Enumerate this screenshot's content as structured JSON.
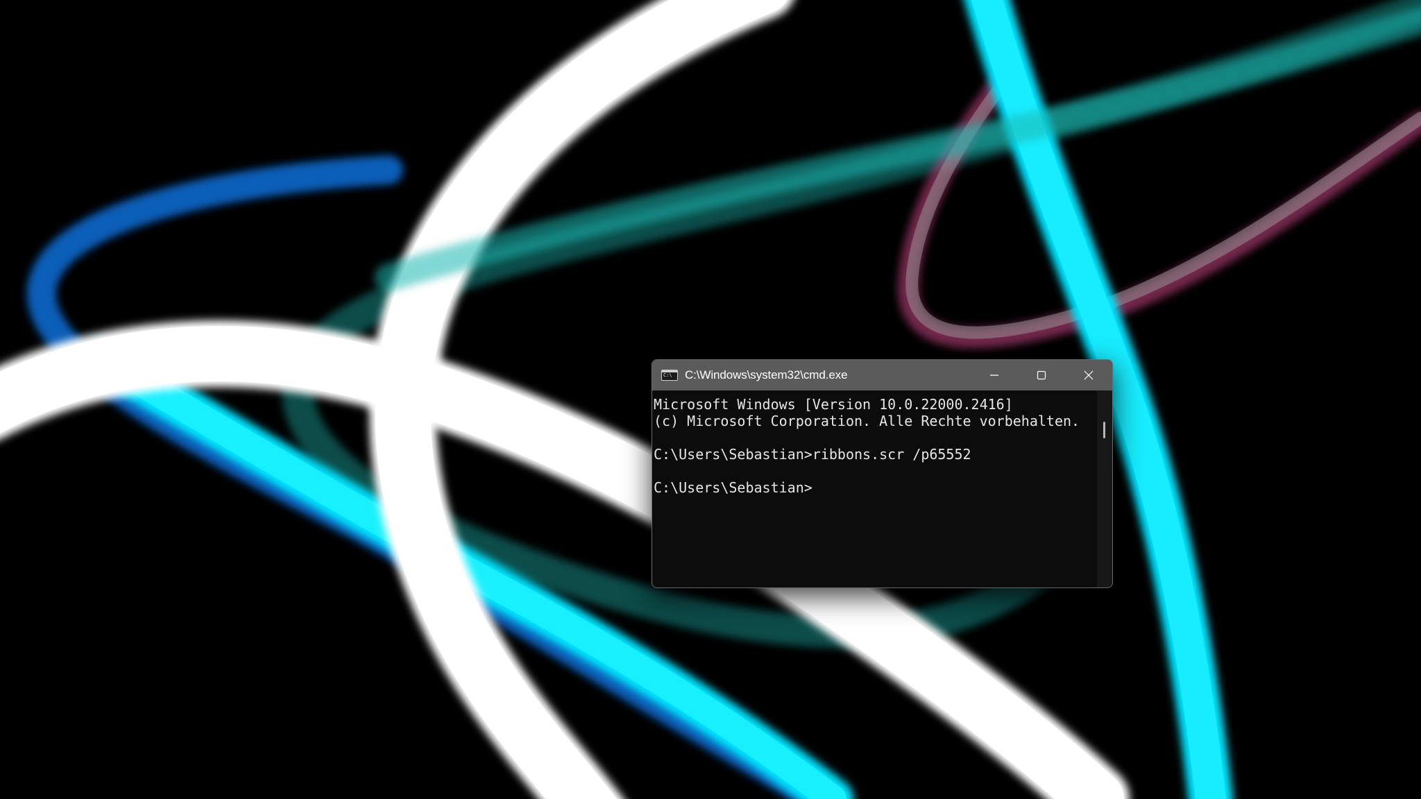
{
  "window": {
    "title": "C:\\Windows\\system32\\cmd.exe",
    "icon": "cmd-console-icon",
    "icon_label": "C:\\",
    "controls": [
      "minimize-icon",
      "maximize-icon",
      "close-icon"
    ]
  },
  "console": {
    "lines": [
      "Microsoft Windows [Version 10.0.22000.2416]",
      "(c) Microsoft Corporation. Alle Rechte vorbehalten.",
      "",
      "C:\\Users\\Sebastian>ribbons.scr /p65552",
      "",
      "C:\\Users\\Sebastian>"
    ]
  },
  "theme": {
    "console_bg": "#0c0c0c",
    "title_bar_bg": "#5b5b5b",
    "text_color": "#e6e6e6",
    "ribbon_colors": [
      "#ffffff",
      "#00e5ff",
      "#1a8fff",
      "#19b5b0",
      "#ff4d9a",
      "#808080"
    ]
  }
}
